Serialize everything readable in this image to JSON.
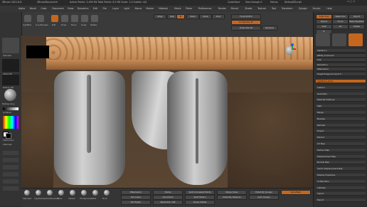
{
  "titlebar": {
    "app": "ZBrush 2021.6.6",
    "doc_prefix": "ZBrushDocument",
    "info": "Active Points: 3,499 Mil  Total Points: 6.5 Mil  Scale: 1.0  Subdiv: 4/4",
    "buttons": [
      "QuickSave",
      "See-through 0",
      "Menus",
      "DefaultZScript"
    ]
  },
  "menus": [
    "Alpha",
    "Brush",
    "Color",
    "Document",
    "Draw",
    "Dynamics",
    "Edit",
    "File",
    "Layer",
    "Light",
    "Macro",
    "Marker",
    "Material",
    "Movie",
    "Picker",
    "Preferences",
    "Render",
    "Stencil",
    "Stroke",
    "Texture",
    "Tool",
    "Transform",
    "Zplugin",
    "Zscript",
    "Help"
  ],
  "toolbar": {
    "top_labels": [
      "Zadd",
      "Zsub",
      "Zcut",
      "Rgb",
      "M",
      "Mrgb",
      "Focal Shift 0",
      "Z Intensity 25",
      "Draw Size 64",
      "Dynamic"
    ],
    "tools": [
      "Home Page",
      "LightBox",
      "Live Boolean",
      "Edit",
      "Draw",
      "Move",
      "Scale",
      "Rotate"
    ]
  },
  "left_shelf": {
    "labels": [
      "Standard",
      "Alpha Off",
      "Texture Off",
      "MatCap Gray",
      "Gradient",
      "SwitchColor",
      "Alternate"
    ]
  },
  "bottom": {
    "brushes": [
      "Standard",
      "ClayBuildup",
      "DamStandard",
      "Move",
      "hPolish",
      "TrimDynamic",
      "Inflat",
      "Pinch"
    ],
    "buttons": [
      "ZRemesher",
      "Del Lower",
      "Del Higher",
      "Divide",
      "Dynamesh",
      "Resolution 128",
      "Split Unmasked Points",
      "Split Hidden",
      "Group Visible",
      "Merge Down",
      "Polish By Features",
      "Polish By Groups",
      "Auto Groups",
      "DynaMesh"
    ]
  },
  "right_panel": {
    "top": [
      "Copy Tool",
      "Paste Tool",
      "Import",
      "Export",
      "Clone",
      "Make PolyMesh3D",
      "GoZ",
      "All",
      "Visible",
      "R"
    ],
    "sections": [
      "Lightbox ▸ Tools",
      "Subtool",
      "Geometry",
      "Mask By Features",
      "Split",
      "Merge",
      "Boolean",
      "Remesh",
      "Project",
      "Extract",
      "UV Map",
      "Texture Map",
      "Displacement Map",
      "Normal Map",
      "Vector Displacement Map",
      "Display Properties",
      "Unified Skin",
      "Initialize",
      "Import",
      "Export"
    ],
    "values": [
      "SubTool 1",
      "PM3D_Ornament",
      "Smt",
      "Resolution",
      "ZRemesher",
      "Target Polygons Count 5",
      "Half",
      "Same",
      "Double",
      "Adapt",
      "Use Polypaint"
    ]
  },
  "colors": {
    "accent": "#c4661e",
    "canvas_bg": "#54412f",
    "wood": "#d29a6a",
    "gray_model": "#bdbdbd"
  }
}
